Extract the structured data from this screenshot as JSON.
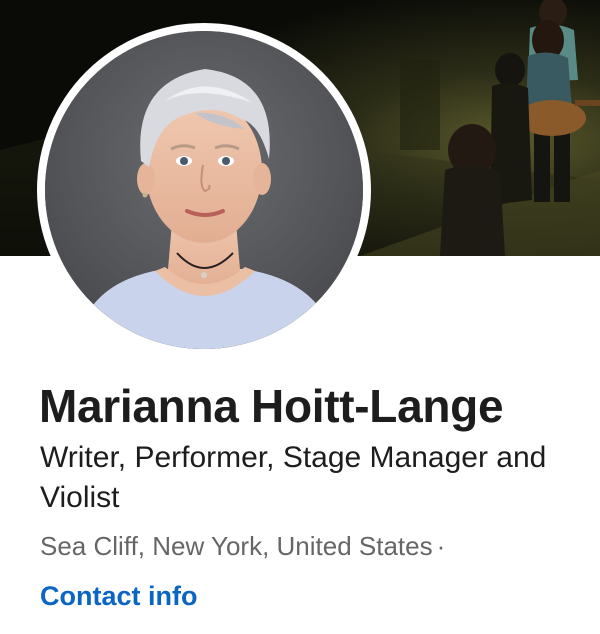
{
  "profile": {
    "name": "Marianna Hoitt-Lange",
    "headline": "Writer, Performer, Stage Manager and Violist",
    "location": "Sea Cliff, New York, United States",
    "location_separator": "·",
    "contact_label": "Contact info"
  },
  "colors": {
    "link": "#0a66c2",
    "text_primary": "#1d1d1d",
    "text_secondary": "#666666",
    "background": "#ffffff"
  }
}
